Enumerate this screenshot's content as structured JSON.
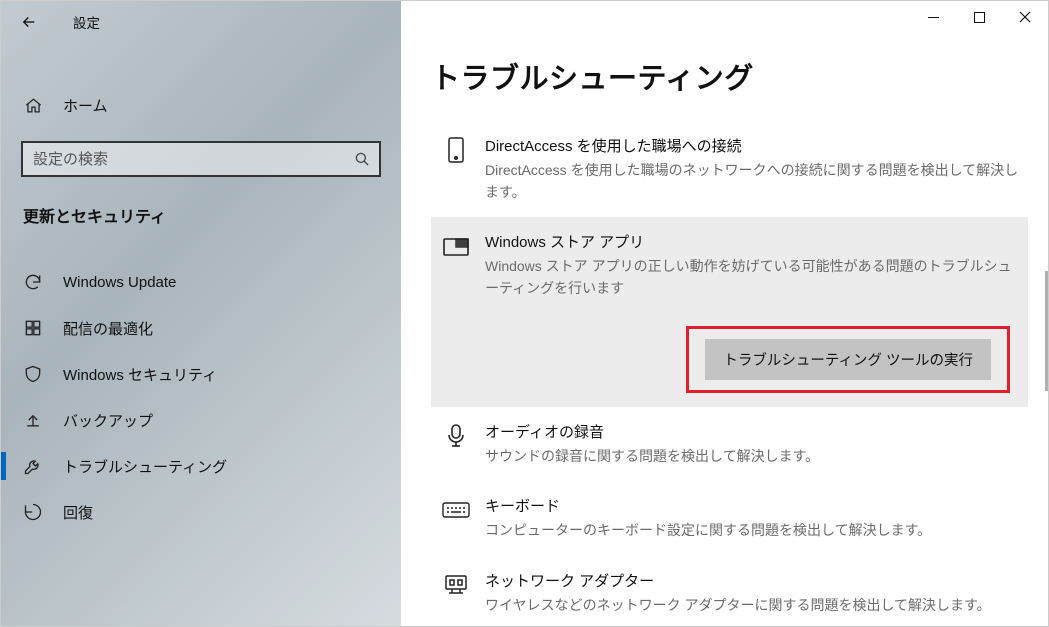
{
  "app_title": "設定",
  "home_label": "ホーム",
  "search_placeholder": "設定の検索",
  "section_header": "更新とセキュリティ",
  "nav": [
    {
      "label": "Windows Update",
      "icon": "sync"
    },
    {
      "label": "配信の最適化",
      "icon": "delivery"
    },
    {
      "label": "Windows セキュリティ",
      "icon": "shield"
    },
    {
      "label": "バックアップ",
      "icon": "backup"
    },
    {
      "label": "トラブルシューティング",
      "icon": "troubleshoot",
      "selected": true
    },
    {
      "label": "回復",
      "icon": "recovery"
    }
  ],
  "page_title": "トラブルシューティング",
  "items": [
    {
      "title": "DirectAccess を使用した職場への接続",
      "desc": "DirectAccess を使用した職場のネットワークへの接続に関する問題を検出して解決します。",
      "icon": "phone"
    },
    {
      "title": "Windows ストア アプリ",
      "desc": "Windows ストア アプリの正しい動作を妨げている可能性がある問題のトラブルシューティングを行います",
      "icon": "store",
      "selected": true,
      "action": "トラブルシューティング ツールの実行"
    },
    {
      "title": "オーディオの録音",
      "desc": "サウンドの録音に関する問題を検出して解決します。",
      "icon": "mic"
    },
    {
      "title": "キーボード",
      "desc": "コンピューターのキーボード設定に関する問題を検出して解決します。",
      "icon": "keyboard"
    },
    {
      "title": "ネットワーク アダプター",
      "desc": "ワイヤレスなどのネットワーク アダプターに関する問題を検出して解決します。",
      "icon": "netadapter"
    }
  ],
  "colors": {
    "accent": "#0067c0",
    "highlight_border": "#e01f2d"
  }
}
